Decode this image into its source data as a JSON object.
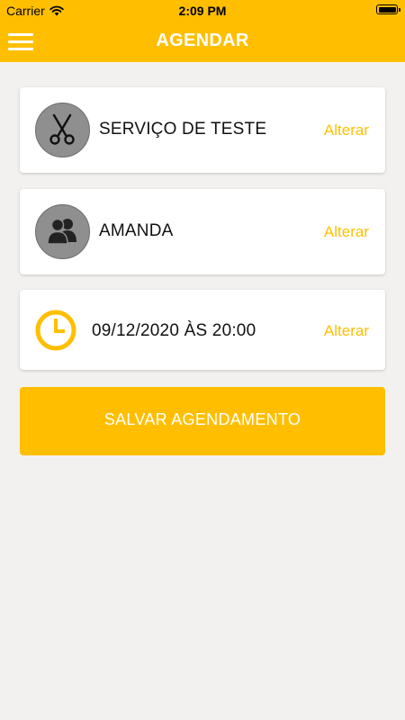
{
  "status_bar": {
    "carrier": "Carrier",
    "time": "2:09 PM",
    "icons": [
      "wifi-icon",
      "battery-icon"
    ]
  },
  "header": {
    "title": "AGENDAR",
    "menu_icon": "hamburger-menu-icon",
    "background_color": "#ffbf00"
  },
  "service": {
    "name": "SERVIÇO DE TESTE",
    "action": "Alterar",
    "icon": "scissors-icon"
  },
  "professional": {
    "name": "AMANDA",
    "action": "Alterar",
    "icon": "users-icon"
  },
  "datetime": {
    "value": "09/12/2020 ÀS 20:00",
    "action": "Alterar",
    "icon": "clock-icon"
  },
  "save_button": {
    "label": "SALVAR AGENDAMENTO"
  },
  "colors": {
    "accent": "#ffbf00",
    "background": "#f2f1ef",
    "card": "#ffffff",
    "avatar": "#8f8f8f"
  }
}
